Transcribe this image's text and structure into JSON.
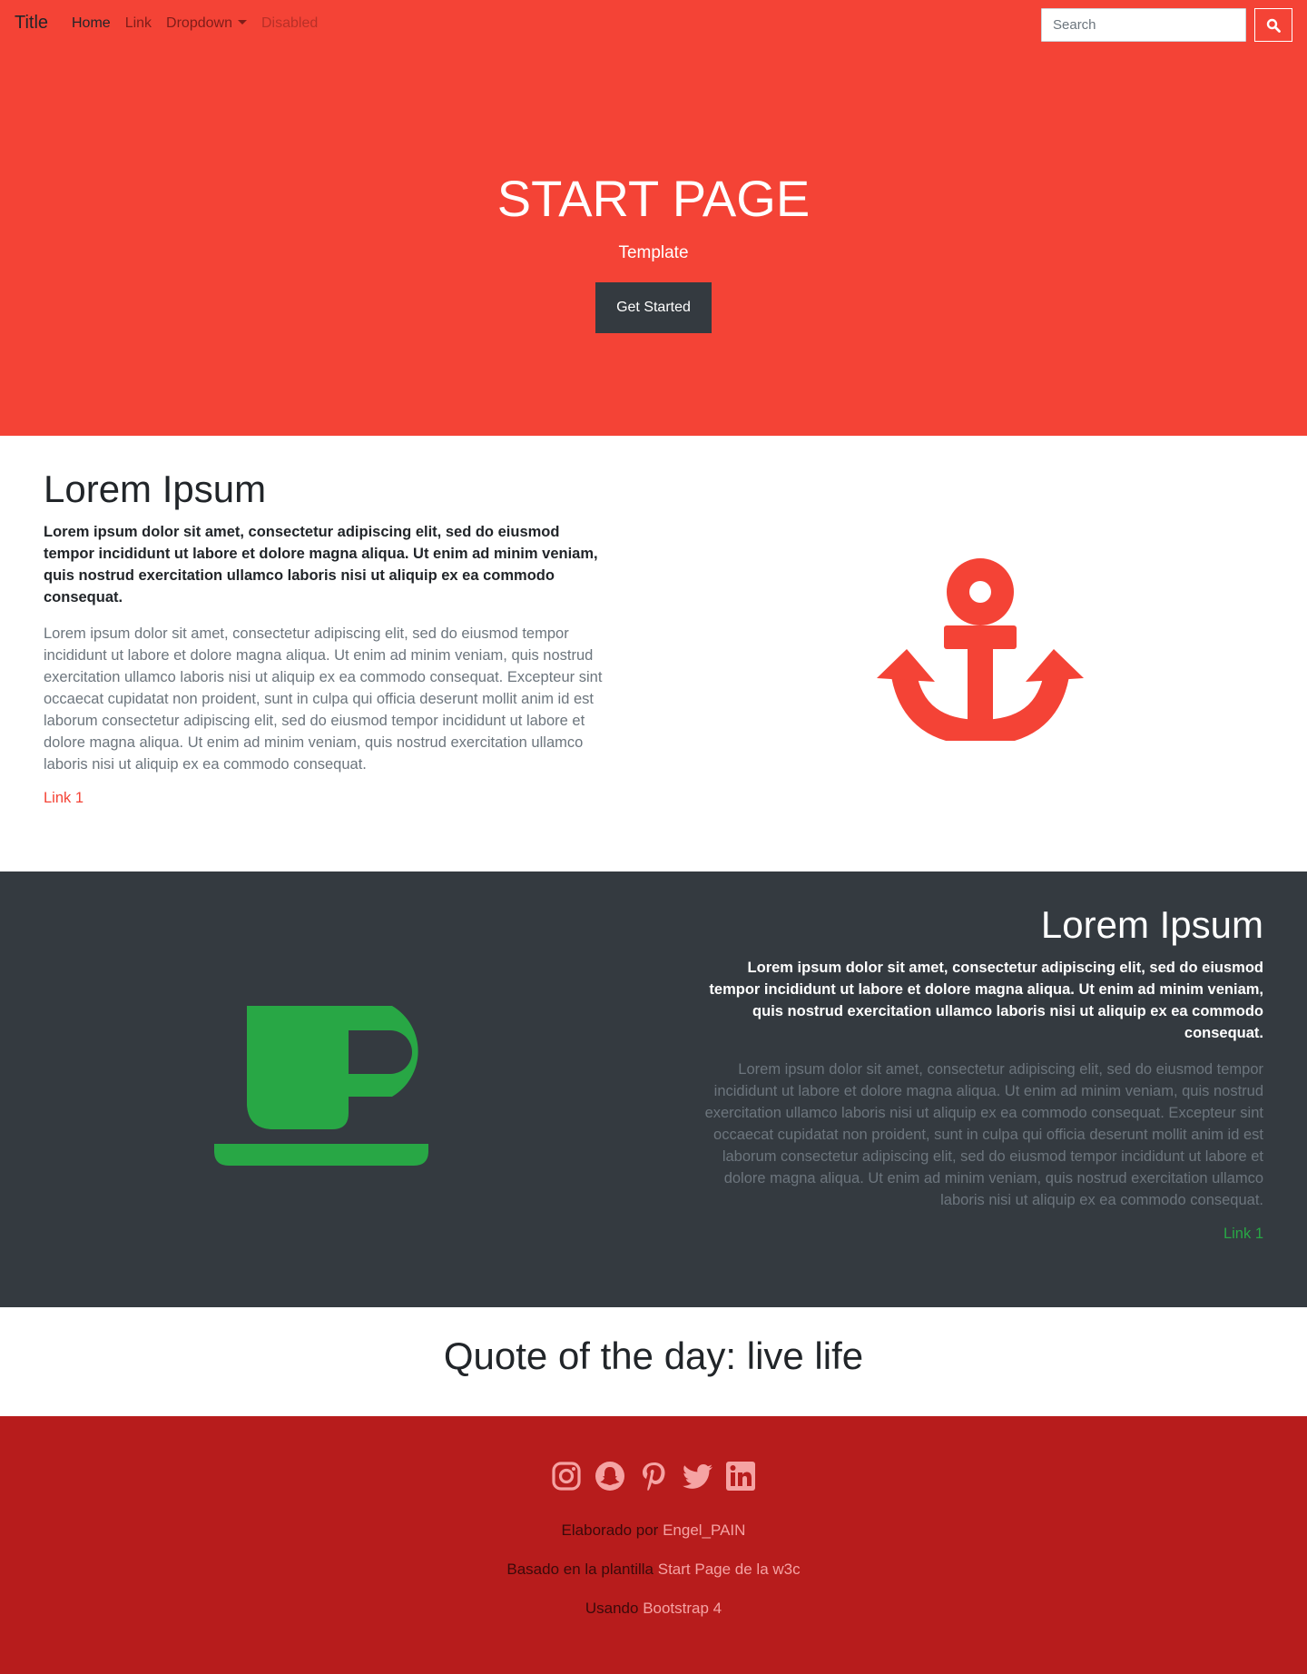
{
  "navbar": {
    "brand": "Title",
    "links": [
      "Home",
      "Link",
      "Dropdown",
      "Disabled"
    ],
    "search_placeholder": "Search"
  },
  "hero": {
    "title": "START PAGE",
    "subtitle": "Template",
    "button": "Get Started"
  },
  "section1": {
    "heading": "Lorem Ipsum",
    "lead": "Lorem ipsum dolor sit amet, consectetur adipiscing elit, sed do eiusmod tempor incididunt ut labore et dolore magna aliqua. Ut enim ad minim veniam, quis nostrud exercitation ullamco laboris nisi ut aliquip ex ea commodo consequat.",
    "body": "Lorem ipsum dolor sit amet, consectetur adipiscing elit, sed do eiusmod tempor incididunt ut labore et dolore magna aliqua. Ut enim ad minim veniam, quis nostrud exercitation ullamco laboris nisi ut aliquip ex ea commodo consequat. Excepteur sint occaecat cupidatat non proident, sunt in culpa qui officia deserunt mollit anim id est laborum consectetur adipiscing elit, sed do eiusmod tempor incididunt ut labore et dolore magna aliqua. Ut enim ad minim veniam, quis nostrud exercitation ullamco laboris nisi ut aliquip ex ea commodo consequat.",
    "link": "Link 1",
    "icon": "anchor-icon"
  },
  "section2": {
    "heading": "Lorem Ipsum",
    "lead": "Lorem ipsum dolor sit amet, consectetur adipiscing elit, sed do eiusmod tempor incididunt ut labore et dolore magna aliqua. Ut enim ad minim veniam, quis nostrud exercitation ullamco laboris nisi ut aliquip ex ea commodo consequat.",
    "body": "Lorem ipsum dolor sit amet, consectetur adipiscing elit, sed do eiusmod tempor incididunt ut labore et dolore magna aliqua. Ut enim ad minim veniam, quis nostrud exercitation ullamco laboris nisi ut aliquip ex ea commodo consequat. Excepteur sint occaecat cupidatat non proident, sunt in culpa qui officia deserunt mollit anim id est laborum consectetur adipiscing elit, sed do eiusmod tempor incididunt ut labore et dolore magna aliqua. Ut enim ad minim veniam, quis nostrud exercitation ullamco laboris nisi ut aliquip ex ea commodo consequat.",
    "link": "Link 1",
    "icon": "coffee-icon"
  },
  "quote": "Quote of the day: live life",
  "footer": {
    "social": [
      "instagram-icon",
      "snapchat-icon",
      "pinterest-icon",
      "twitter-icon",
      "linkedin-icon"
    ],
    "line1_prefix": "Elaborado por ",
    "line1_link": "Engel_PAIN",
    "line2_prefix": "Basado en la plantilla ",
    "line2_link": "Start Page de la w3c",
    "line3_prefix": "Usando ",
    "line3_link": "Bootstrap 4"
  },
  "colors": {
    "primary": "#f44336",
    "dark": "#343a40",
    "footer": "#b71c1c",
    "success": "#28a745",
    "muted": "#6c757d"
  }
}
